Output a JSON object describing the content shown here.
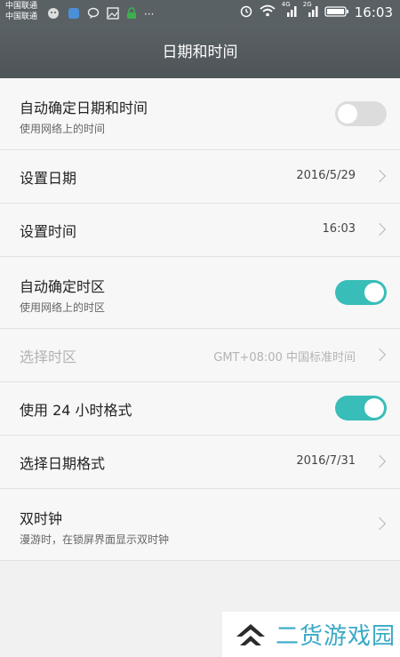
{
  "status_bar": {
    "carrier_1": "中国联通",
    "carrier_2": "中国联通",
    "time": "16:03",
    "network_1": "4G",
    "network_2": "2G",
    "more": "···"
  },
  "app_bar": {
    "title": "日期和时间"
  },
  "settings": {
    "auto_datetime": {
      "label": "自动确定日期和时间",
      "sub": "使用网络上的时间",
      "enabled": false
    },
    "set_date": {
      "label": "设置日期",
      "value": "2016/5/29"
    },
    "set_time": {
      "label": "设置时间",
      "value": "16:03"
    },
    "auto_timezone": {
      "label": "自动确定时区",
      "sub": "使用网络上的时区",
      "enabled": true
    },
    "select_timezone": {
      "label": "选择时区",
      "value": "GMT+08:00 中国标准时间"
    },
    "use_24h": {
      "label": "使用 24 小时格式",
      "enabled": true
    },
    "date_format": {
      "label": "选择日期格式",
      "value": "2016/7/31"
    },
    "dual_clock": {
      "label": "双时钟",
      "sub": "漫游时，在锁屏界面显示双时钟"
    }
  },
  "colors": {
    "accent": "#39bdb8",
    "toggle_off": "#dcdcdc",
    "bar": "#5a6165"
  },
  "watermark": {
    "text": "二货游戏园"
  }
}
